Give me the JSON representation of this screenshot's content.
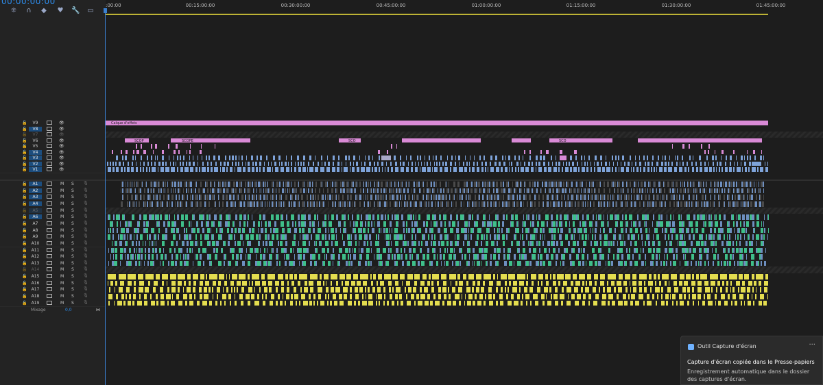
{
  "timecode": "00:00:00:00",
  "toolbar": {
    "tools": [
      {
        "name": "snap-icon",
        "glyph": "⁜"
      },
      {
        "name": "linked-selection-icon",
        "glyph": "∩"
      },
      {
        "name": "add-marker-icon",
        "glyph": "◆"
      },
      {
        "name": "marker-icon",
        "glyph": "♥"
      },
      {
        "name": "wrench-icon",
        "glyph": "🔧"
      },
      {
        "name": "captions-icon",
        "glyph": "▭"
      }
    ]
  },
  "ruler": {
    "labels": [
      ":00:00",
      "00:15:00:00",
      "00:30:00:00",
      "00:45:00:00",
      "01:00:00:00",
      "01:15:00:00",
      "01:30:00:00",
      "01:45:00:00"
    ]
  },
  "colors": {
    "video_pink": "#d98ad6",
    "video_blue": "#7ea3d9",
    "audio_blue": "#6e8fc0",
    "audio_green": "#3fbf8a",
    "audio_yellow": "#e4dd4f",
    "active_track": "#1c4d7e",
    "accent": "#2d8ceb"
  },
  "video_tracks": [
    {
      "name": "V9",
      "active": false,
      "dim": false
    },
    {
      "name": "V8",
      "active": true,
      "dim": false
    },
    {
      "name": "V7",
      "active": false,
      "dim": true
    },
    {
      "name": "V6",
      "active": false,
      "dim": false
    },
    {
      "name": "V5",
      "active": false,
      "dim": false
    },
    {
      "name": "V4",
      "active": true,
      "dim": false
    },
    {
      "name": "V3",
      "active": true,
      "dim": false
    },
    {
      "name": "V2",
      "active": true,
      "dim": false
    },
    {
      "name": "V1",
      "active": true,
      "dim": false
    }
  ],
  "audio_tracks": [
    {
      "name": "A1",
      "active": true,
      "dim": false
    },
    {
      "name": "A2",
      "active": true,
      "dim": false
    },
    {
      "name": "A3",
      "active": true,
      "dim": false
    },
    {
      "name": "A4",
      "active": true,
      "dim": false
    },
    {
      "name": "A5",
      "active": true,
      "dim": true
    },
    {
      "name": "A6",
      "active": true,
      "dim": false
    },
    {
      "name": "A7",
      "active": false,
      "dim": false
    },
    {
      "name": "A8",
      "active": false,
      "dim": false
    },
    {
      "name": "A9",
      "active": false,
      "dim": false
    },
    {
      "name": "A10",
      "active": false,
      "dim": false
    },
    {
      "name": "A11",
      "active": false,
      "dim": false
    },
    {
      "name": "A12",
      "active": false,
      "dim": false
    },
    {
      "name": "A13",
      "active": false,
      "dim": false
    },
    {
      "name": "A14",
      "active": false,
      "dim": true
    },
    {
      "name": "A15",
      "active": false,
      "dim": false
    },
    {
      "name": "A16",
      "active": false,
      "dim": false
    },
    {
      "name": "A17",
      "active": false,
      "dim": false
    },
    {
      "name": "A18",
      "active": false,
      "dim": false
    },
    {
      "name": "A19",
      "active": false,
      "dim": false
    }
  ],
  "audio_buttons": {
    "mute": "M",
    "solo": "S"
  },
  "clip_labels": {
    "adjustment_layer": "Calque d'effets",
    "scop": "SCOP",
    "scope": "SCOPE",
    "sco": "SCO"
  },
  "mix": {
    "label": "Mixage",
    "value": "0,0"
  },
  "notification": {
    "app": "Outil Capture d'écran",
    "more": "···",
    "title": "Capture d'écran copiée dans le Presse-papiers",
    "body": "Enregistrement automatique dans le dossier des captures d'écran."
  }
}
